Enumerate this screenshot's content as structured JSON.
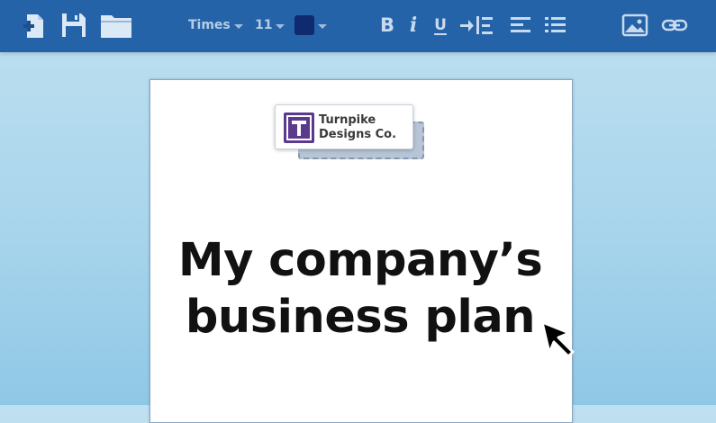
{
  "toolbar": {
    "new_icon": "new-document-icon",
    "save_icon": "save-icon",
    "open_icon": "folder-icon",
    "font_family": "Times",
    "font_size": "11",
    "text_color": "#0f2a6e",
    "bold_label": "B",
    "italic_label": "i",
    "underline_label": "U",
    "indent_icon": "indent-icon",
    "align_icon": "align-left-icon",
    "list_icon": "bulleted-list-icon",
    "image_icon": "image-icon",
    "link_icon": "link-icon"
  },
  "document": {
    "logo": {
      "line1": "Turnpike",
      "line2": "Designs Co.",
      "brand_color": "#5b3a8e"
    },
    "title_line1": "My company’s",
    "title_line2": "business plan"
  },
  "colors": {
    "toolbar_bg": "#2563a8",
    "icon": "#dbe8f5",
    "background": "#a9d5ec"
  }
}
